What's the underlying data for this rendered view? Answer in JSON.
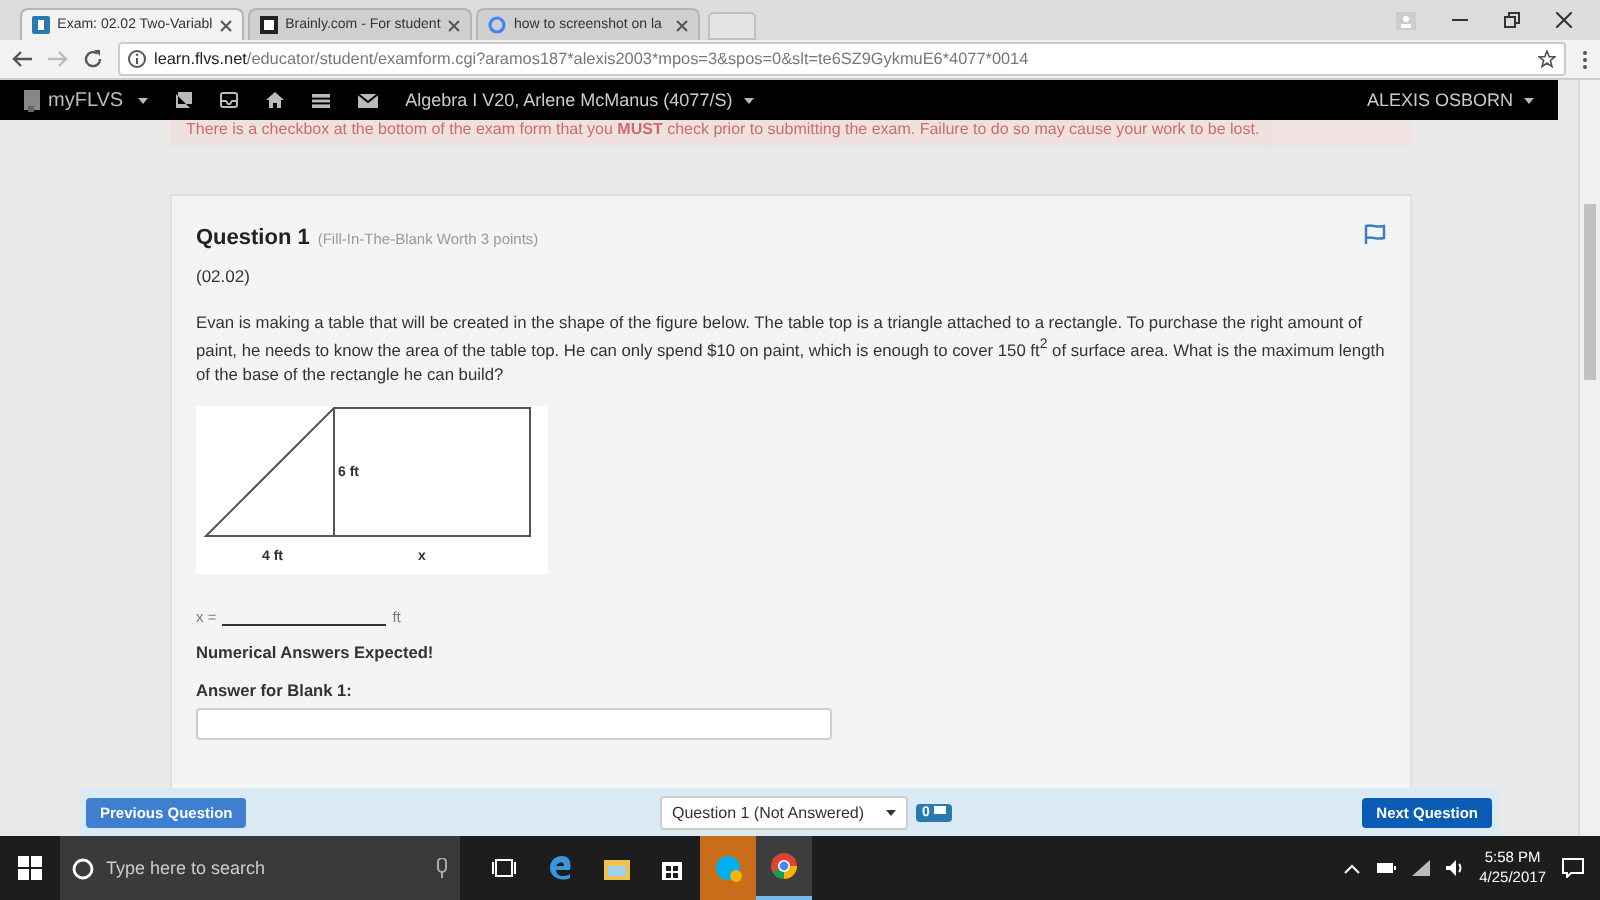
{
  "browser": {
    "tabs": [
      {
        "title": "Exam: 02.02 Two-Variabl",
        "selected": true,
        "kind": "flvs"
      },
      {
        "title": "Brainly.com - For student",
        "selected": false,
        "kind": "brainly"
      },
      {
        "title": "how to screenshot on la",
        "selected": false,
        "kind": "google"
      }
    ],
    "address": {
      "domain": "learn.flvs.net",
      "path": "/educator/student/examform.cgi?aramos187*alexis2003*mpos=3&spos=0&slt=te6SZ9GykmuE6*4077*0014"
    }
  },
  "nav": {
    "brand": "myFLVS",
    "course": "Algebra I V20, Arlene McManus (4077/S)",
    "user": "ALEXIS OSBORN"
  },
  "alert": "There is a checkbox at the bottom of the exam form that you **MUST** check prior to submitting the exam. Failure to do so may cause your work to be lost.",
  "question": {
    "title": "Question 1",
    "meta": "(Fill-In-The-Blank Worth 3 points)",
    "code": "(02.02)",
    "body": "Evan is making a table that will be created in the shape of the figure below. The table top is a triangle attached to a rectangle. To purchase the right amount of paint, he needs to know the area of the table top. He can only spend $10 on paint, which is enough to cover 150 ft$^{2}$ of surface area. What is the maximum length of the base of the rectangle he can build?",
    "figure": {
      "height_label": "6 ft",
      "base_label": "4 ft",
      "x_label": "x"
    },
    "blank": {
      "prefix": "x =",
      "suffix": "ft"
    },
    "note": "Numerical Answers Expected!",
    "answer_label": "Answer for Blank 1:"
  },
  "footer": {
    "previous": "Previous Question",
    "question_select": "Question 1 (Not Answered)",
    "flag_count": "0",
    "next": "Next Question"
  },
  "taskbar": {
    "search_placeholder": "Type here to search",
    "apps": [
      {
        "kind": "taskview",
        "selected": false
      },
      {
        "kind": "edge",
        "selected": false
      },
      {
        "kind": "explorer",
        "selected": false
      },
      {
        "kind": "store",
        "selected": false
      },
      {
        "kind": "skype",
        "selected": false
      },
      {
        "kind": "chrome",
        "selected": true
      }
    ],
    "time": "5:58 PM",
    "date": "4/25/2017"
  }
}
